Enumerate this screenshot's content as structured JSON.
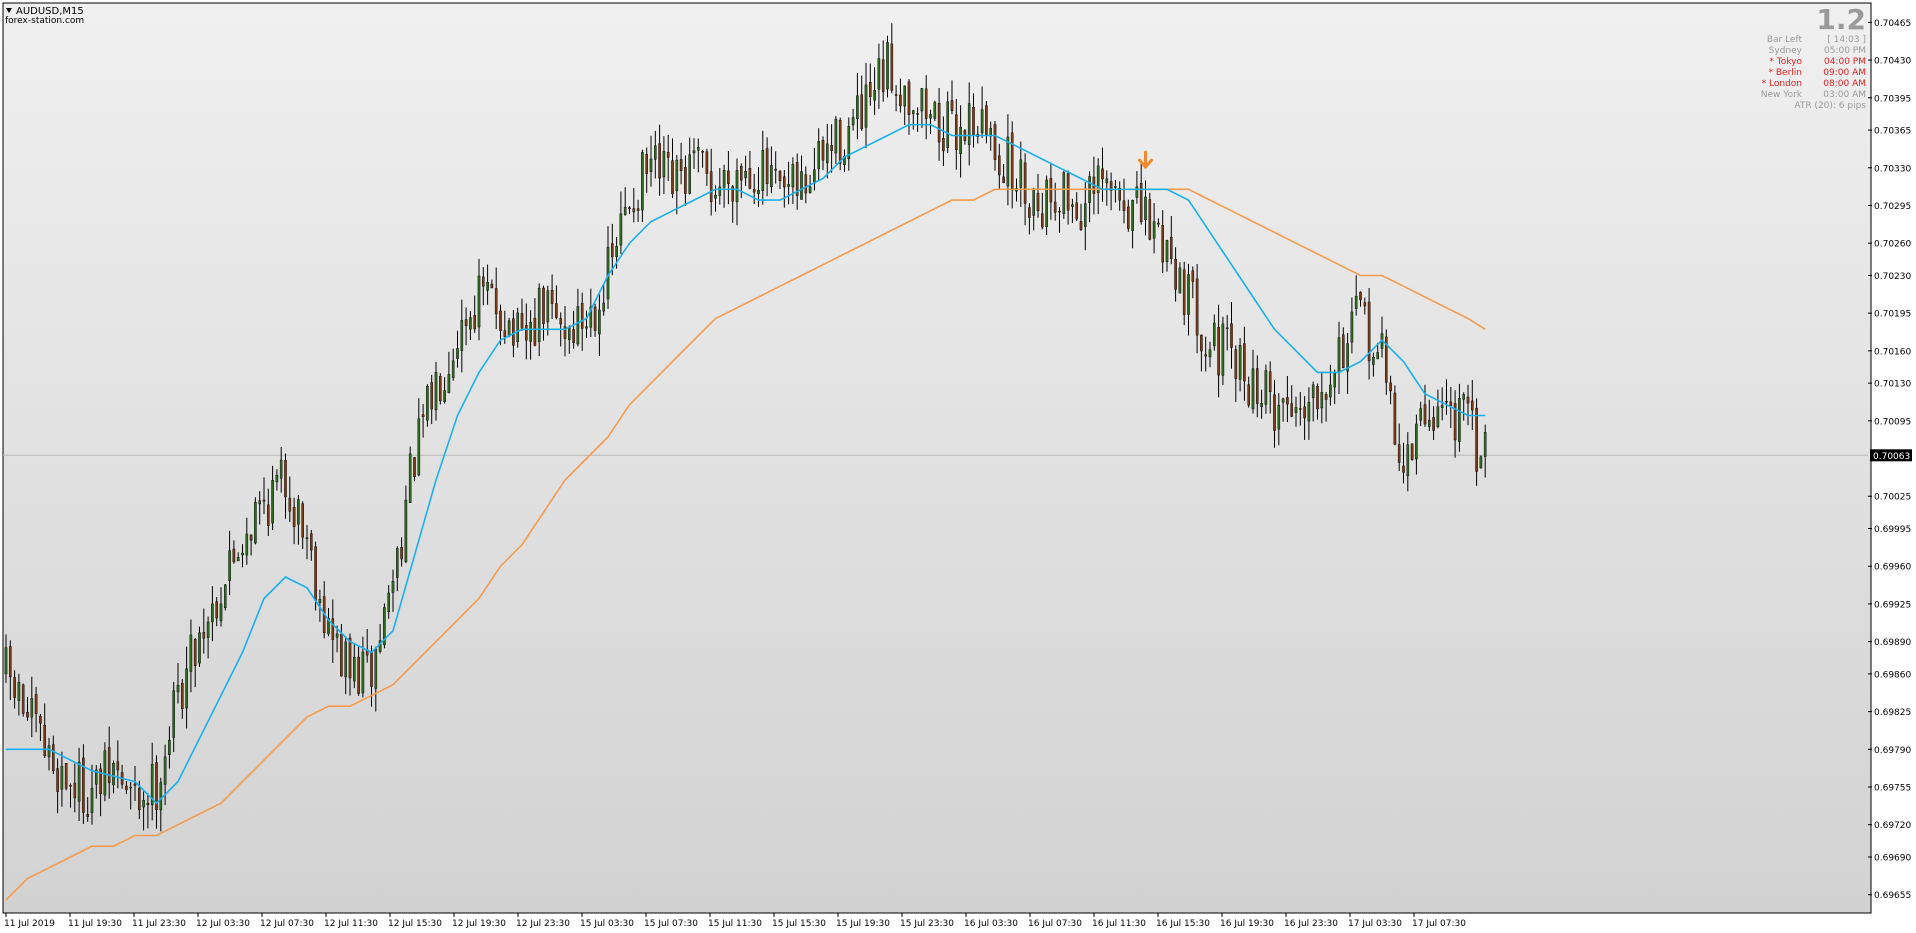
{
  "window": {
    "symbol_title": "AUDUSD,M15",
    "watermark": "forex-station.com"
  },
  "info_panel": {
    "big_value": "1.2",
    "rows": [
      {
        "label": "Bar Left",
        "value": "[ 14:03 ]",
        "color": "#9a9a9a"
      },
      {
        "label": "Sydney",
        "value": "05:00 PM",
        "color": "#9a9a9a"
      },
      {
        "label": "* Tokyo",
        "value": "04:00 PM",
        "color": "#e02020"
      },
      {
        "label": "* Berlin",
        "value": "09:00 AM",
        "color": "#e02020"
      },
      {
        "label": "* London",
        "value": "08:00 AM",
        "color": "#e02020"
      },
      {
        "label": "New York",
        "value": "03:00 AM",
        "color": "#9a9a9a"
      }
    ],
    "atr_text": "ATR (20): 6 pips"
  },
  "colors": {
    "bg_top": "#f0f0f0",
    "bg_bottom": "#d2d2d2",
    "bull": "#2e6b1e",
    "bear": "#7b3a16",
    "ma_fast": "#1ab0ee",
    "ma_slow": "#f59b4e",
    "signal_arrow": "#f08a30",
    "price_line": "#b8b8b8"
  },
  "chart_data": {
    "type": "candlestick",
    "symbol": "AUDUSD",
    "timeframe": "M15",
    "ylim": [
      0.69638,
      0.70483
    ],
    "y_ticks": [
      "0.70465",
      "0.70430",
      "0.70395",
      "0.70365",
      "0.70330",
      "0.70295",
      "0.70260",
      "0.70230",
      "0.70195",
      "0.70160",
      "0.70130",
      "0.70095",
      "0.70063",
      "0.70025",
      "0.69995",
      "0.69960",
      "0.69925",
      "0.69890",
      "0.69860",
      "0.69825",
      "0.69790",
      "0.69755",
      "0.69720",
      "0.69690",
      "0.69655"
    ],
    "x_ticks": [
      "11 Jul 2019",
      "11 Jul 19:30",
      "11 Jul 23:30",
      "12 Jul 03:30",
      "12 Jul 07:30",
      "12 Jul 11:30",
      "12 Jul 15:30",
      "12 Jul 19:30",
      "12 Jul 23:30",
      "15 Jul 03:30",
      "15 Jul 07:30",
      "15 Jul 11:30",
      "15 Jul 15:30",
      "15 Jul 19:30",
      "15 Jul 23:30",
      "16 Jul 03:30",
      "16 Jul 07:30",
      "16 Jul 11:30",
      "16 Jul 15:30",
      "16 Jul 19:30",
      "16 Jul 23:30",
      "17 Jul 03:30",
      "17 Jul 07:30"
    ],
    "current_price": "0.70063",
    "close_path": [
      [
        0,
        0.6986
      ],
      [
        5,
        0.6982
      ],
      [
        10,
        0.6978
      ],
      [
        15,
        0.6976
      ],
      [
        20,
        0.6975
      ],
      [
        25,
        0.6977
      ],
      [
        30,
        0.6974
      ],
      [
        35,
        0.6976
      ],
      [
        40,
        0.6984
      ],
      [
        45,
        0.699
      ],
      [
        50,
        0.6994
      ],
      [
        55,
        0.6999
      ],
      [
        60,
        0.7002
      ],
      [
        65,
        0.7004
      ],
      [
        70,
        0.6999
      ],
      [
        75,
        0.699
      ],
      [
        80,
        0.6986
      ],
      [
        85,
        0.6986
      ],
      [
        90,
        0.6995
      ],
      [
        95,
        0.7006
      ],
      [
        100,
        0.7013
      ],
      [
        105,
        0.7018
      ],
      [
        110,
        0.7021
      ],
      [
        115,
        0.702
      ],
      [
        120,
        0.7016
      ],
      [
        125,
        0.702
      ],
      [
        130,
        0.7018
      ],
      [
        135,
        0.7019
      ],
      [
        140,
        0.7023
      ],
      [
        145,
        0.703
      ],
      [
        150,
        0.7033
      ],
      [
        155,
        0.7031
      ],
      [
        160,
        0.7033
      ],
      [
        165,
        0.7031
      ],
      [
        170,
        0.7033
      ],
      [
        175,
        0.7033
      ],
      [
        180,
        0.703
      ],
      [
        185,
        0.7031
      ],
      [
        190,
        0.7034
      ],
      [
        195,
        0.7036
      ],
      [
        200,
        0.7038
      ],
      [
        205,
        0.7042
      ],
      [
        210,
        0.704
      ],
      [
        215,
        0.7038
      ],
      [
        220,
        0.7036
      ],
      [
        225,
        0.7038
      ],
      [
        230,
        0.7035
      ],
      [
        235,
        0.7032
      ],
      [
        240,
        0.703
      ],
      [
        245,
        0.7031
      ],
      [
        250,
        0.7029
      ],
      [
        255,
        0.7031
      ],
      [
        260,
        0.703
      ],
      [
        265,
        0.7028
      ],
      [
        270,
        0.7026
      ],
      [
        275,
        0.7021
      ],
      [
        280,
        0.7017
      ],
      [
        285,
        0.7015
      ],
      [
        290,
        0.7013
      ],
      [
        295,
        0.7011
      ],
      [
        300,
        0.7011
      ],
      [
        305,
        0.7013
      ],
      [
        310,
        0.7016
      ],
      [
        315,
        0.7019
      ],
      [
        320,
        0.7015
      ],
      [
        325,
        0.7005
      ],
      [
        330,
        0.701
      ],
      [
        335,
        0.7011
      ],
      [
        340,
        0.7009
      ],
      [
        344,
        0.7006
      ]
    ],
    "ma_fast": [
      [
        0,
        0.6979
      ],
      [
        10,
        0.6979
      ],
      [
        15,
        0.6978
      ],
      [
        20,
        0.6977
      ],
      [
        30,
        0.6976
      ],
      [
        35,
        0.6974
      ],
      [
        40,
        0.6976
      ],
      [
        45,
        0.698
      ],
      [
        50,
        0.6984
      ],
      [
        55,
        0.6988
      ],
      [
        60,
        0.6993
      ],
      [
        65,
        0.6995
      ],
      [
        70,
        0.6994
      ],
      [
        75,
        0.6991
      ],
      [
        80,
        0.6989
      ],
      [
        85,
        0.6988
      ],
      [
        90,
        0.699
      ],
      [
        95,
        0.6997
      ],
      [
        100,
        0.7004
      ],
      [
        105,
        0.701
      ],
      [
        110,
        0.7014
      ],
      [
        115,
        0.7017
      ],
      [
        120,
        0.7018
      ],
      [
        125,
        0.7018
      ],
      [
        130,
        0.7018
      ],
      [
        135,
        0.7019
      ],
      [
        140,
        0.7023
      ],
      [
        145,
        0.7026
      ],
      [
        150,
        0.7028
      ],
      [
        155,
        0.7029
      ],
      [
        160,
        0.703
      ],
      [
        165,
        0.7031
      ],
      [
        170,
        0.7031
      ],
      [
        175,
        0.703
      ],
      [
        180,
        0.703
      ],
      [
        185,
        0.7031
      ],
      [
        190,
        0.7032
      ],
      [
        195,
        0.7034
      ],
      [
        200,
        0.7035
      ],
      [
        205,
        0.7036
      ],
      [
        210,
        0.7037
      ],
      [
        215,
        0.7037
      ],
      [
        220,
        0.7036
      ],
      [
        225,
        0.7036
      ],
      [
        230,
        0.7036
      ],
      [
        235,
        0.7035
      ],
      [
        240,
        0.7034
      ],
      [
        245,
        0.7033
      ],
      [
        250,
        0.7032
      ],
      [
        255,
        0.7031
      ],
      [
        260,
        0.7031
      ],
      [
        265,
        0.7031
      ],
      [
        270,
        0.7031
      ],
      [
        275,
        0.703
      ],
      [
        280,
        0.7027
      ],
      [
        285,
        0.7024
      ],
      [
        290,
        0.7021
      ],
      [
        295,
        0.7018
      ],
      [
        300,
        0.7016
      ],
      [
        305,
        0.7014
      ],
      [
        310,
        0.7014
      ],
      [
        315,
        0.7015
      ],
      [
        320,
        0.7017
      ],
      [
        325,
        0.7015
      ],
      [
        330,
        0.7012
      ],
      [
        335,
        0.7011
      ],
      [
        340,
        0.701
      ],
      [
        344,
        0.701
      ]
    ],
    "ma_slow": [
      [
        0,
        0.6965
      ],
      [
        5,
        0.6967
      ],
      [
        10,
        0.6968
      ],
      [
        15,
        0.6969
      ],
      [
        20,
        0.697
      ],
      [
        25,
        0.697
      ],
      [
        30,
        0.6971
      ],
      [
        35,
        0.6971
      ],
      [
        40,
        0.6972
      ],
      [
        45,
        0.6973
      ],
      [
        50,
        0.6974
      ],
      [
        55,
        0.6976
      ],
      [
        60,
        0.6978
      ],
      [
        65,
        0.698
      ],
      [
        70,
        0.6982
      ],
      [
        75,
        0.6983
      ],
      [
        80,
        0.6983
      ],
      [
        85,
        0.6984
      ],
      [
        90,
        0.6985
      ],
      [
        95,
        0.6987
      ],
      [
        100,
        0.6989
      ],
      [
        105,
        0.6991
      ],
      [
        110,
        0.6993
      ],
      [
        115,
        0.6996
      ],
      [
        120,
        0.6998
      ],
      [
        125,
        0.7001
      ],
      [
        130,
        0.7004
      ],
      [
        135,
        0.7006
      ],
      [
        140,
        0.7008
      ],
      [
        145,
        0.7011
      ],
      [
        150,
        0.7013
      ],
      [
        155,
        0.7015
      ],
      [
        160,
        0.7017
      ],
      [
        165,
        0.7019
      ],
      [
        170,
        0.702
      ],
      [
        175,
        0.7021
      ],
      [
        180,
        0.7022
      ],
      [
        185,
        0.7023
      ],
      [
        190,
        0.7024
      ],
      [
        195,
        0.7025
      ],
      [
        200,
        0.7026
      ],
      [
        205,
        0.7027
      ],
      [
        210,
        0.7028
      ],
      [
        215,
        0.7029
      ],
      [
        220,
        0.703
      ],
      [
        225,
        0.703
      ],
      [
        230,
        0.7031
      ],
      [
        235,
        0.7031
      ],
      [
        240,
        0.7031
      ],
      [
        245,
        0.7031
      ],
      [
        250,
        0.7031
      ],
      [
        255,
        0.7031
      ],
      [
        260,
        0.7031
      ],
      [
        265,
        0.7031
      ],
      [
        270,
        0.7031
      ],
      [
        275,
        0.7031
      ],
      [
        280,
        0.703
      ],
      [
        285,
        0.7029
      ],
      [
        290,
        0.7028
      ],
      [
        295,
        0.7027
      ],
      [
        300,
        0.7026
      ],
      [
        305,
        0.7025
      ],
      [
        310,
        0.7024
      ],
      [
        315,
        0.7023
      ],
      [
        320,
        0.7023
      ],
      [
        325,
        0.7022
      ],
      [
        330,
        0.7021
      ],
      [
        335,
        0.702
      ],
      [
        340,
        0.7019
      ],
      [
        344,
        0.7018
      ]
    ],
    "signal_arrow": {
      "bar": 265,
      "price": 0.70338,
      "direction": "down"
    },
    "bar_count": 345
  }
}
